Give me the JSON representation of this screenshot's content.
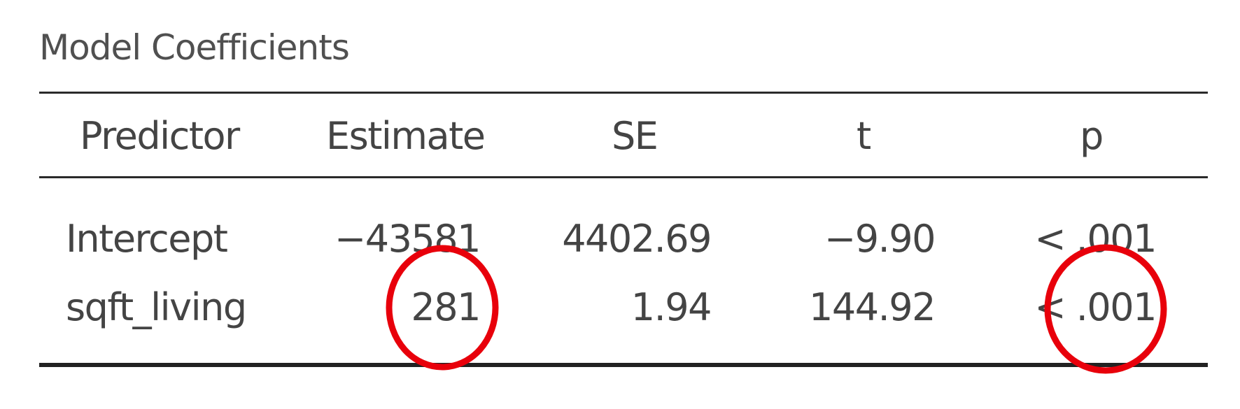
{
  "table": {
    "title": "Model Coefficients",
    "headers": {
      "predictor": "Predictor",
      "estimate": "Estimate",
      "se": "SE",
      "t": "t",
      "p": "p"
    },
    "rows": [
      {
        "predictor": "Intercept",
        "estimate": "−43581",
        "se": "4402.69",
        "t": "−9.90",
        "p": "< .001"
      },
      {
        "predictor": "sqft_living",
        "estimate": "281",
        "se": "1.94",
        "t": "144.92",
        "p": "< .001"
      }
    ]
  },
  "annotations": {
    "circle_color": "#e8000b",
    "highlighted_cells": [
      "sqft_living estimate",
      "sqft_living p"
    ]
  }
}
